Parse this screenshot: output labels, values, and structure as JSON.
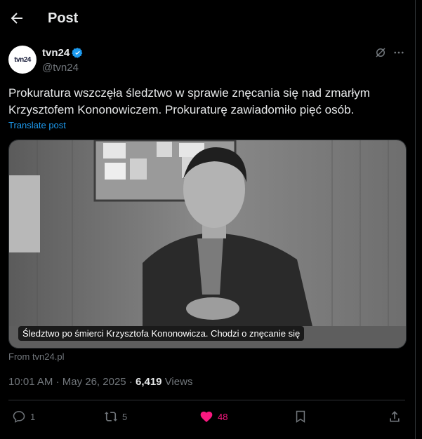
{
  "header": {
    "title": "Post"
  },
  "post": {
    "author_name": "tvn24",
    "handle": "@tvn24",
    "avatar_text": "tvn24",
    "text": "Prokuratura wszczęła śledztwo w sprawie znęcania się nad zmarłym\nKrzysztofem Kononowiczem. Prokuraturę zawiadomiło pięć osób.",
    "translate_label": "Translate post",
    "media_caption": "Śledztwo po śmierci Krzysztofa Kononowicza. Chodzi o znęcanie się",
    "from_label": "From tvn24.pl",
    "time": "10:01 AM",
    "date": "May 26, 2025",
    "views_count": "6,419",
    "views_label": "Views"
  },
  "actions": {
    "replies": "1",
    "reposts": "5",
    "likes": "48"
  },
  "colors": {
    "accent": "#1d9bf0",
    "like": "#f91880",
    "muted": "#71767b"
  },
  "icons": [
    "back-arrow-icon",
    "verified-badge-icon",
    "grok-icon",
    "more-icon",
    "reply-icon",
    "repost-icon",
    "heart-icon",
    "bookmark-icon",
    "share-icon"
  ]
}
